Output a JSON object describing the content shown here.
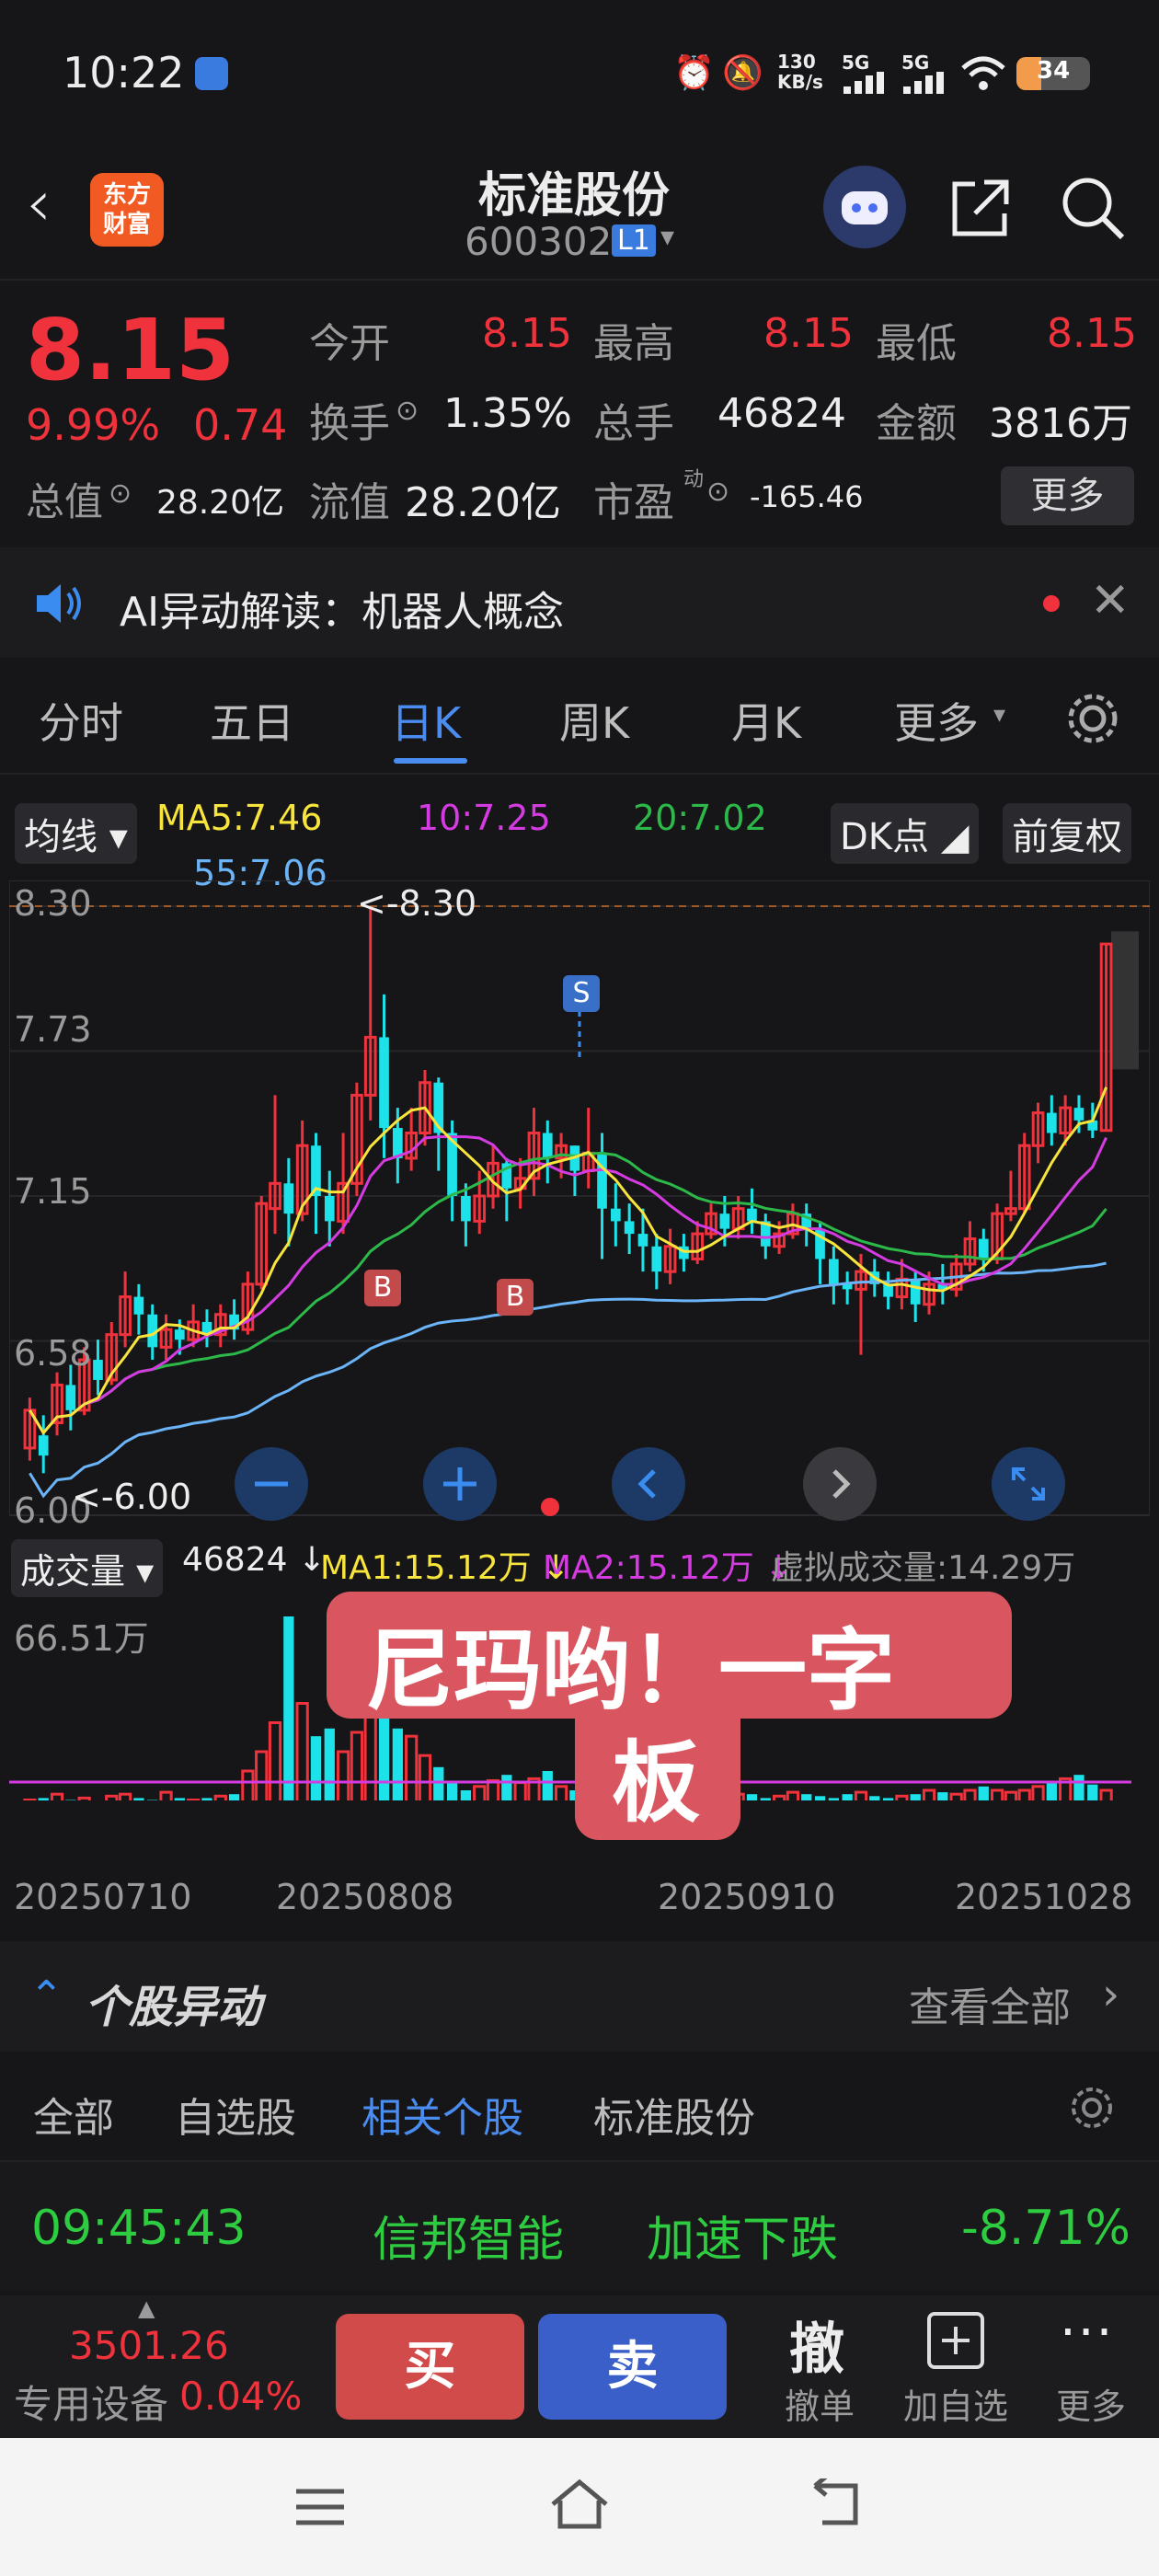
{
  "status": {
    "time": "10:22",
    "net_speed_top": "130",
    "net_speed_unit": "KB/s",
    "sig1": "5G",
    "sig2": "5G",
    "battery": "34"
  },
  "header": {
    "title": "标准股份",
    "code": "600302",
    "level": "L1",
    "logo_line1": "东方",
    "logo_line2": "财富"
  },
  "quote": {
    "price": "8.15",
    "pct": "9.99%",
    "chg": "0.74",
    "open_label": "今开",
    "open": "8.15",
    "high_label": "最高",
    "high": "8.15",
    "low_label": "最低",
    "low": "8.15",
    "turnover_label": "换手",
    "turnover": "1.35%",
    "vol_label": "总手",
    "vol": "46824",
    "amount_label": "金额",
    "amount": "3816万",
    "mcap_label": "总值",
    "mcap": "28.20亿",
    "float_label": "流值",
    "float": "28.20亿",
    "pe_label": "市盈",
    "pe_sup": "动",
    "pe": "-165.46",
    "more": "更多"
  },
  "ai": {
    "text": "AI异动解读：机器人概念"
  },
  "tabs": [
    "分时",
    "五日",
    "日K",
    "周K",
    "月K",
    "更多"
  ],
  "ma": {
    "btn": "均线",
    "ma5": "MA5:7.46",
    "ma10": "10:7.25",
    "ma20": "20:7.02",
    "ma55": "55:7.06",
    "dk": "DK点",
    "fq": "前复权"
  },
  "axis": {
    "y": [
      "8.30",
      "7.73",
      "7.15",
      "6.58",
      "6.00"
    ],
    "hi_marker": "<-8.30",
    "lo_marker": "<-6.00",
    "vol_max": "66.51万",
    "x": [
      "20250710",
      "20250808",
      "20250910",
      "20251028"
    ]
  },
  "signals": {
    "s": "S",
    "b": "B"
  },
  "volbar": {
    "btn": "成交量",
    "v": "46824",
    "ma1": "MA1:15.12万",
    "ma2": "MA2:15.12万",
    "virtual": "虚拟成交量:14.29万"
  },
  "caption": {
    "line1": "尼玛哟！一字",
    "line2": "板"
  },
  "moves": {
    "title": "个股异动",
    "view_all": "查看全部"
  },
  "subtabs": [
    "全部",
    "自选股",
    "相关个股",
    "标准股份"
  ],
  "row": {
    "time": "09:45:43",
    "name": "信邦智能",
    "event": "加速下跌",
    "pct": "-8.71%"
  },
  "bottom": {
    "index": "3501.26",
    "sector": "专用设备",
    "sector_pct": "0.04%",
    "buy": "买",
    "sell": "卖",
    "cancel_big": "撤",
    "cancel": "撤单",
    "add": "加自选",
    "more": "更多"
  },
  "colors": {
    "up": "#f0323c",
    "down": "#1de2e9",
    "ma5": "#f7e43c",
    "ma10": "#d43be0",
    "ma20": "#2db84a",
    "ma55": "#6ab4f7",
    "accent": "#4a8cf0"
  },
  "chart_data": {
    "type": "candlestick",
    "x": [
      "20250710",
      "20250808",
      "20250910",
      "20251028"
    ],
    "ylim": [
      6.0,
      8.3
    ],
    "candles": [
      [
        6.15,
        6.3,
        6.1,
        6.35
      ],
      [
        6.2,
        6.12,
        6.05,
        6.28
      ],
      [
        6.25,
        6.4,
        6.2,
        6.45
      ],
      [
        6.4,
        6.3,
        6.22,
        6.48
      ],
      [
        6.3,
        6.5,
        6.28,
        6.55
      ],
      [
        6.5,
        6.42,
        6.36,
        6.58
      ],
      [
        6.42,
        6.6,
        6.4,
        6.65
      ],
      [
        6.6,
        6.75,
        6.55,
        6.85
      ],
      [
        6.75,
        6.68,
        6.6,
        6.8
      ],
      [
        6.68,
        6.55,
        6.5,
        6.72
      ],
      [
        6.55,
        6.62,
        6.5,
        6.68
      ],
      [
        6.62,
        6.58,
        6.52,
        6.66
      ],
      [
        6.58,
        6.65,
        6.55,
        6.72
      ],
      [
        6.65,
        6.6,
        6.55,
        6.7
      ],
      [
        6.6,
        6.68,
        6.55,
        6.72
      ],
      [
        6.68,
        6.62,
        6.58,
        6.74
      ],
      [
        6.62,
        6.8,
        6.6,
        6.85
      ],
      [
        6.8,
        7.12,
        6.78,
        7.15
      ],
      [
        7.1,
        7.2,
        7.0,
        7.55
      ],
      [
        7.2,
        7.08,
        6.95,
        7.3
      ],
      [
        7.08,
        7.35,
        7.05,
        7.45
      ],
      [
        7.35,
        7.15,
        7.0,
        7.4
      ],
      [
        7.15,
        7.05,
        6.95,
        7.25
      ],
      [
        7.05,
        7.2,
        7.0,
        7.4
      ],
      [
        7.2,
        7.55,
        7.15,
        7.6
      ],
      [
        7.55,
        7.78,
        7.45,
        8.3
      ],
      [
        7.78,
        7.42,
        7.3,
        7.95
      ],
      [
        7.42,
        7.3,
        7.2,
        7.5
      ],
      [
        7.3,
        7.4,
        7.25,
        7.5
      ],
      [
        7.4,
        7.6,
        7.35,
        7.65
      ],
      [
        7.6,
        7.4,
        7.25,
        7.62
      ],
      [
        7.4,
        7.15,
        7.05,
        7.45
      ],
      [
        7.15,
        7.05,
        6.95,
        7.2
      ],
      [
        7.05,
        7.15,
        7.0,
        7.25
      ],
      [
        7.15,
        7.28,
        7.1,
        7.35
      ],
      [
        7.28,
        7.18,
        7.05,
        7.3
      ],
      [
        7.18,
        7.22,
        7.1,
        7.3
      ],
      [
        7.22,
        7.4,
        7.15,
        7.5
      ],
      [
        7.4,
        7.3,
        7.2,
        7.45
      ],
      [
        7.3,
        7.35,
        7.22,
        7.4
      ],
      [
        7.35,
        7.25,
        7.15,
        7.35
      ],
      [
        7.25,
        7.32,
        7.18,
        7.5
      ],
      [
        7.32,
        7.1,
        6.9,
        7.4
      ],
      [
        7.1,
        7.05,
        6.95,
        7.2
      ],
      [
        7.05,
        7.0,
        6.92,
        7.12
      ],
      [
        7.0,
        6.95,
        6.85,
        7.1
      ],
      [
        6.95,
        6.85,
        6.78,
        7.0
      ],
      [
        6.85,
        6.95,
        6.8,
        7.02
      ],
      [
        6.95,
        6.9,
        6.85,
        7.0
      ],
      [
        6.9,
        7.0,
        6.88,
        7.05
      ],
      [
        7.0,
        7.08,
        6.98,
        7.12
      ],
      [
        7.08,
        7.02,
        6.95,
        7.15
      ],
      [
        7.02,
        7.1,
        6.98,
        7.15
      ],
      [
        7.1,
        7.05,
        7.0,
        7.18
      ],
      [
        7.05,
        6.95,
        6.9,
        7.08
      ],
      [
        6.95,
        7.0,
        6.92,
        7.05
      ],
      [
        7.0,
        7.08,
        6.98,
        7.12
      ],
      [
        7.08,
        7.02,
        6.95,
        7.12
      ],
      [
        7.02,
        6.9,
        6.8,
        7.05
      ],
      [
        6.9,
        6.8,
        6.72,
        6.95
      ],
      [
        6.8,
        6.78,
        6.72,
        6.85
      ],
      [
        6.78,
        6.85,
        6.52,
        6.92
      ],
      [
        6.85,
        6.8,
        6.75,
        6.9
      ],
      [
        6.8,
        6.75,
        6.7,
        6.85
      ],
      [
        6.75,
        6.82,
        6.7,
        6.9
      ],
      [
        6.82,
        6.72,
        6.65,
        6.85
      ],
      [
        6.72,
        6.8,
        6.68,
        6.85
      ],
      [
        6.8,
        6.78,
        6.72,
        6.88
      ],
      [
        6.78,
        6.88,
        6.75,
        6.92
      ],
      [
        6.88,
        6.98,
        6.85,
        7.05
      ],
      [
        6.98,
        6.9,
        6.85,
        7.02
      ],
      [
        6.9,
        7.08,
        6.88,
        7.12
      ],
      [
        7.08,
        7.1,
        7.05,
        7.25
      ],
      [
        7.1,
        7.35,
        7.08,
        7.4
      ],
      [
        7.35,
        7.48,
        7.28,
        7.52
      ],
      [
        7.48,
        7.4,
        7.35,
        7.55
      ],
      [
        7.4,
        7.5,
        7.35,
        7.55
      ],
      [
        7.5,
        7.45,
        7.4,
        7.55
      ],
      [
        7.45,
        7.41,
        7.38,
        7.52
      ],
      [
        7.41,
        8.15,
        7.41,
        8.15
      ]
    ],
    "volume_pct": [
      5,
      6,
      8,
      5,
      6,
      4,
      7,
      8,
      6,
      5,
      9,
      6,
      5,
      6,
      7,
      8,
      20,
      30,
      45,
      100,
      55,
      38,
      42,
      30,
      40,
      60,
      55,
      42,
      38,
      28,
      22,
      14,
      10,
      12,
      15,
      18,
      14,
      16,
      20,
      12,
      10,
      9,
      8,
      10,
      9,
      8,
      7,
      6,
      7,
      8,
      10,
      9,
      8,
      8,
      6,
      7,
      9,
      8,
      7,
      6,
      8,
      9,
      7,
      6,
      7,
      8,
      10,
      9,
      8,
      10,
      12,
      10,
      9,
      10,
      12,
      14,
      16,
      18,
      13,
      10
    ]
  }
}
